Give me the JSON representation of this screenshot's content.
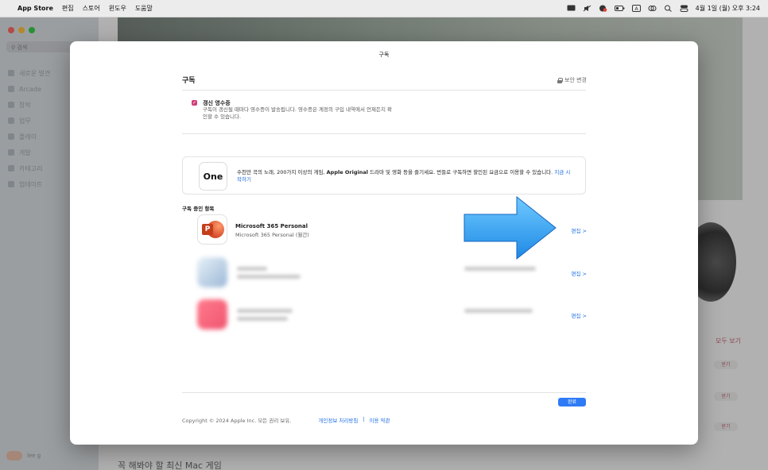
{
  "menubar": {
    "app_name": "App Store",
    "items": [
      "편집",
      "스토어",
      "윈도우",
      "도움말"
    ],
    "clock": "4월 1일 (월) 오후 3:24"
  },
  "sidebar": {
    "search_placeholder": "검색",
    "items": [
      "새로운 발견",
      "Arcade",
      "창작",
      "업무",
      "플레이",
      "개발",
      "카테고리",
      "업데이트"
    ],
    "user": "lee g"
  },
  "background": {
    "see_all": "모두 보기",
    "get_label": "받기",
    "bottom_title": "꼭 해봐야 할 최신 Mac 게임"
  },
  "sheet": {
    "title": "구독",
    "section_title": "구독",
    "security_link": "보안 변경",
    "receipt": {
      "checked": true,
      "title": "갱신 영수증",
      "description": "구독이 갱신될 때마다 영수증이 발송됩니다. 영수증은 계정의 구입 내역에서 언제든지 확인할 수 있습니다."
    },
    "promo": {
      "logo_text": "One",
      "text_lead": "수천만 곡의 노래, 200가지 이상의 게임, ",
      "text_bold": "Apple Original",
      "text_rest": " 드라마 및 영화 등을 즐기세요. 번들로 구독하면 할인된 요금으로 이용할 수 있습니다. ",
      "link": "지금 시작하기"
    },
    "subscriptions_label": "구독 중인 항목",
    "subscriptions": [
      {
        "name": "Microsoft 365 Personal",
        "plan": "Microsoft 365 Personal (월간)",
        "edit": "편집 >"
      },
      {
        "name": "",
        "plan": "",
        "edit": "편집 >"
      },
      {
        "name": "",
        "plan": "",
        "edit": "편집 >"
      }
    ],
    "done_button": "완료",
    "footer": {
      "copyright": "Copyright © 2024 Apple Inc. 모든 권리 보유.",
      "privacy": "개인정보 처리방침",
      "separator": "|",
      "terms": "이용 약관"
    }
  },
  "colors": {
    "accent_blue": "#1f6fe5",
    "checkbox_pink": "#d0407a",
    "arrow_blue": "#3aa6f0"
  }
}
